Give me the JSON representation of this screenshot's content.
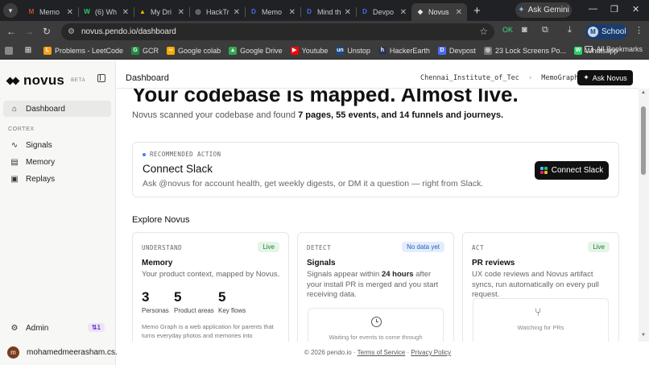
{
  "browser": {
    "tabs": [
      {
        "title": "Memo",
        "color": "#c44f2a",
        "glyph": "M"
      },
      {
        "title": "(6) Wh",
        "color": "#25d366",
        "glyph": "W"
      },
      {
        "title": "My Dri",
        "color": "#f4b400",
        "glyph": "▲"
      },
      {
        "title": "HackTr",
        "color": "#9aa0a6",
        "glyph": "◎"
      },
      {
        "title": "Memo",
        "color": "#4a6cf7",
        "glyph": "D"
      },
      {
        "title": "Mind th",
        "color": "#4a6cf7",
        "glyph": "D"
      },
      {
        "title": "Devpo",
        "color": "#4a6cf7",
        "glyph": "D"
      },
      {
        "title": "Novus",
        "color": "#e8e8e8",
        "glyph": "◆",
        "active": true
      }
    ],
    "new_tab": "+",
    "gemini_label": "Ask Gemini",
    "url": "novus.pendo.io/dashboard",
    "profile_label": "School",
    "profile_initial": "M",
    "bookmarks": [
      {
        "label": "Problems - LeetCode",
        "color": "#f89f1b",
        "glyph": "L"
      },
      {
        "label": "GCR",
        "color": "#1e8e3e",
        "glyph": "G"
      },
      {
        "label": "Google colab",
        "color": "#f9ab00",
        "glyph": "∞"
      },
      {
        "label": "Google Drive",
        "color": "#34a853",
        "glyph": "▲"
      },
      {
        "label": "Youtube",
        "color": "#ff0000",
        "glyph": "▶"
      },
      {
        "label": "Unstop",
        "color": "#1c4980",
        "glyph": "un"
      },
      {
        "label": "HackerEarth",
        "color": "#2c3454",
        "glyph": "h"
      },
      {
        "label": "Devpost",
        "color": "#4a6cf7",
        "glyph": "D"
      },
      {
        "label": "23 Lock Screens Po...",
        "color": "#777777",
        "glyph": "◎"
      },
      {
        "label": "Whatsapp",
        "color": "#25d366",
        "glyph": "W"
      }
    ],
    "all_bookmarks": "All Bookmarks"
  },
  "sidebar": {
    "brand": "novus",
    "beta": "BETA",
    "items_top": [
      {
        "label": "Dashboard",
        "icon": "home-icon"
      }
    ],
    "section_label": "CORTEX",
    "cortex_items": [
      {
        "label": "Signals",
        "icon": "pulse-icon"
      },
      {
        "label": "Memory",
        "icon": "book-icon"
      },
      {
        "label": "Replays",
        "icon": "replay-icon"
      }
    ],
    "admin_label": "Admin",
    "admin_badge": "⇅1",
    "user_name": "mohamedmeerasham.cs..."
  },
  "topbar": {
    "breadcrumb": "Dashboard",
    "org": "Chennai_Institute_of_Tec",
    "project": "MemoGraph",
    "ask_label": "Ask Novus"
  },
  "main": {
    "hero": "Your codebase is mapped. Almost live.",
    "sub_prefix": "Novus scanned your codebase and found ",
    "sub_bold": "7 pages, 55 events, and 14 funnels and journeys.",
    "rec": {
      "kicker": "RECOMMENDED ACTION",
      "title": "Connect Slack",
      "desc": "Ask @novus for account health, get weekly digests, or DM it a question — right from Slack.",
      "button": "Connect Slack"
    },
    "explore_title": "Explore Novus",
    "cards": {
      "memory": {
        "kicker": "UNDERSTAND",
        "badge": "Live",
        "title": "Memory",
        "desc": "Your product context, mapped by Novus.",
        "stats": [
          {
            "n": "3",
            "l": "Personas"
          },
          {
            "n": "5",
            "l": "Product areas"
          },
          {
            "n": "5",
            "l": "Key flows"
          }
        ],
        "blurb": "Memo Graph is a web application for parents that turns everyday photos and memories into"
      },
      "signals": {
        "kicker": "DETECT",
        "badge": "No data yet",
        "title": "Signals",
        "desc_a": "Signals appear within ",
        "desc_b": "24 hours",
        "desc_c": " after your install PR is merged and you start receiving data.",
        "waiting": "Waiting for events to come through"
      },
      "pr": {
        "kicker": "ACT",
        "badge": "Live",
        "title": "PR reviews",
        "desc": "UX code reviews and Novus artifact syncs, run automatically on every pull request.",
        "waiting": "Watching for PRs"
      }
    }
  },
  "footer": {
    "copyright": "© 2026 pendo.io · ",
    "terms": "Terms of Service",
    "sep": " · ",
    "privacy": "Privacy Policy"
  }
}
